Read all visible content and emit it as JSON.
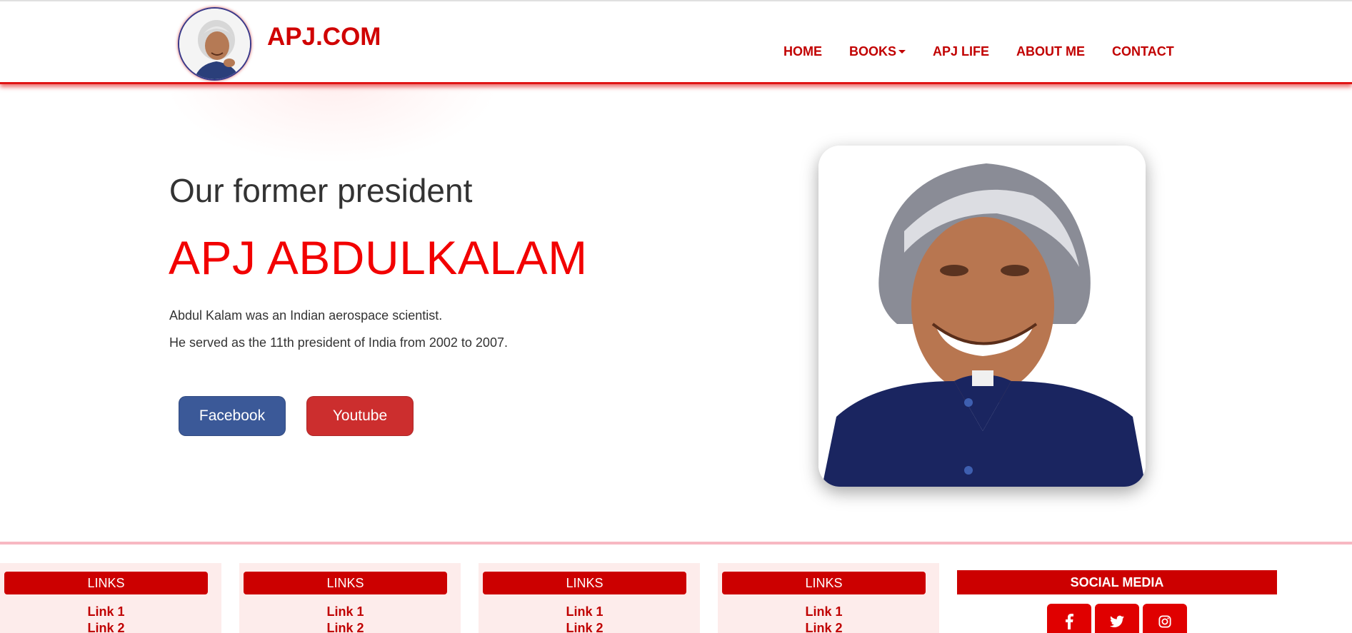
{
  "brand": {
    "name": "APJ.COM",
    "logo_icon": "apj-kalam-portrait-icon"
  },
  "nav": {
    "items": [
      {
        "label": "HOME"
      },
      {
        "label": "BOOKS",
        "has_dropdown": true
      },
      {
        "label": "APJ LIFE"
      },
      {
        "label": "ABOUT ME"
      },
      {
        "label": "CONTACT"
      }
    ]
  },
  "hero": {
    "subtitle": "Our former president",
    "title": "APJ ABDULKALAM",
    "lines": [
      "Abdul Kalam was an Indian aerospace scientist.",
      "He served as the 11th president of India from 2002 to 2007."
    ],
    "buttons": [
      {
        "label": "Facebook",
        "color": "#3b5998"
      },
      {
        "label": "Youtube",
        "color": "#cc2e2e"
      }
    ],
    "portrait_icon": "apj-kalam-photo"
  },
  "footer": {
    "link_columns": [
      {
        "heading": "LINKS",
        "links": [
          "Link 1",
          "Link 2"
        ]
      },
      {
        "heading": "LINKS",
        "links": [
          "Link 1",
          "Link 2"
        ]
      },
      {
        "heading": "LINKS",
        "links": [
          "Link 1",
          "Link 2"
        ]
      },
      {
        "heading": "LINKS",
        "links": [
          "Link 1",
          "Link 2"
        ]
      }
    ],
    "social": {
      "heading": "SOCIAL MEDIA",
      "icons": [
        "facebook-icon",
        "twitter-icon",
        "instagram-icon"
      ]
    }
  },
  "colors": {
    "accent": "#cc0000",
    "title_red": "#f20000",
    "footer_bg": "#fdeceb"
  }
}
